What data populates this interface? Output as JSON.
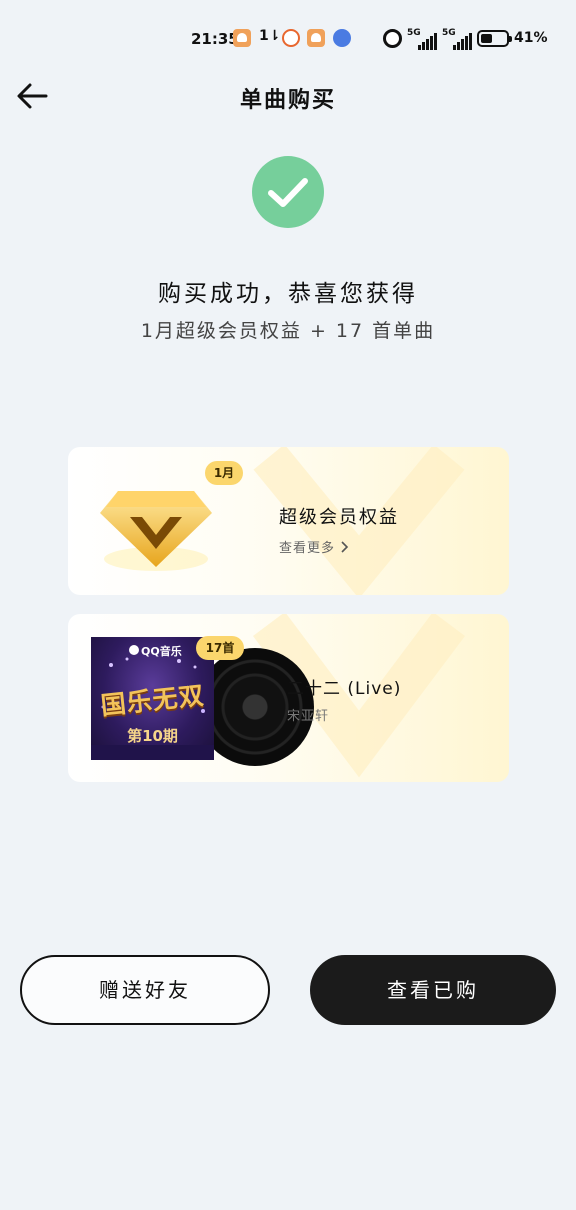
{
  "status_bar": {
    "time": "21:35",
    "data_indicator": "1⇂",
    "signal_1_label": "5G",
    "signal_2_label": "5G",
    "battery": "41%",
    "icons": [
      "heart-app-icon",
      "data-transfer-icon",
      "weibo-icon",
      "heart-app-icon",
      "planet-app-icon",
      "alarm-icon",
      "signal-icon",
      "signal-icon",
      "battery-icon"
    ]
  },
  "header": {
    "title": "单曲购买",
    "back_icon": "back-arrow-icon"
  },
  "success": {
    "icon": "check-icon",
    "icon_color": "#76cf9b",
    "title": "购买成功，恭喜您获得",
    "subtitle": "1月超级会员权益 + 17 首单曲"
  },
  "cards": {
    "membership": {
      "badge": "1月",
      "title": "超级会员权益",
      "link": "查看更多",
      "icon": "diamond-icon"
    },
    "songs": {
      "badge": "17首",
      "title": "二十二 (Live)",
      "artist": "宋亚轩",
      "cover": {
        "brand": "QQ音乐",
        "show_title": "国乐无双",
        "issue": "第10期"
      }
    }
  },
  "actions": {
    "gift_label": "赠送好友",
    "view_label": "查看已购"
  },
  "colors": {
    "background": "#eff3f7",
    "badge": "#fbd66d",
    "primary_button": "#1b1b1b"
  }
}
